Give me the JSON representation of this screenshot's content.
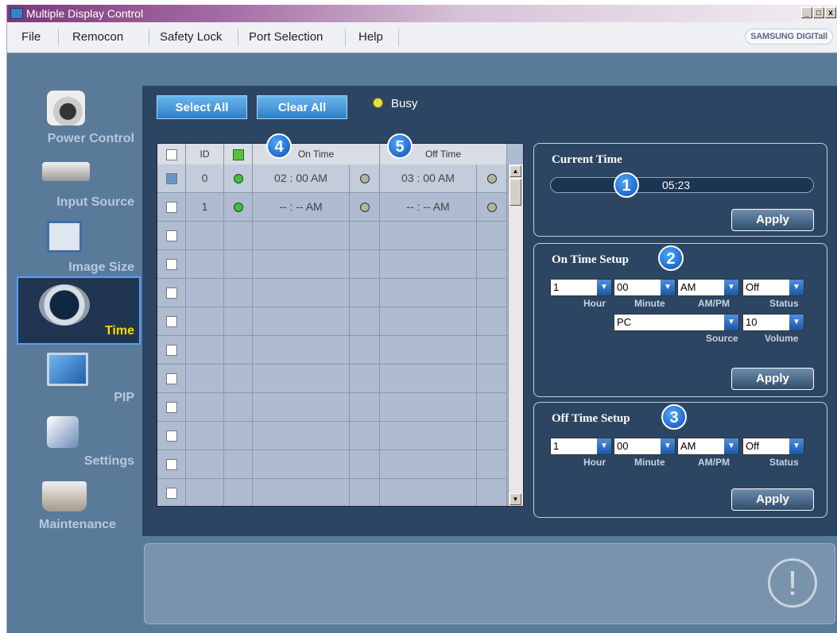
{
  "window": {
    "title": "Multiple Display Control",
    "min": "_",
    "max": "□",
    "close": "x"
  },
  "menu": {
    "items": [
      "File",
      "Remocon",
      "Safety Lock",
      "Port Selection",
      "Help"
    ],
    "brand": "SAMSUNG DIGITall"
  },
  "sidebar": {
    "items": [
      {
        "label": "Power Control",
        "icon": "power-control-icon"
      },
      {
        "label": "Input Source",
        "icon": "input-source-icon"
      },
      {
        "label": "Image Size",
        "icon": "image-size-icon"
      },
      {
        "label": "Time",
        "icon": "clock-icon",
        "active": true
      },
      {
        "label": "PIP",
        "icon": "pip-icon"
      },
      {
        "label": "Settings",
        "icon": "settings-icon"
      },
      {
        "label": "Maintenance",
        "icon": "maintenance-icon"
      }
    ]
  },
  "toolbar": {
    "select_all": "Select All",
    "clear_all": "Clear All",
    "busy": "Busy"
  },
  "grid": {
    "headers": {
      "id": "ID",
      "on_time": "On Time",
      "off_time": "Off Time"
    },
    "rows": [
      {
        "checked": true,
        "id": "0",
        "status": "green",
        "on_time": "02 : 00 AM",
        "on_led": "gray",
        "off_time": "03 : 00 AM",
        "off_led": "gray"
      },
      {
        "checked": false,
        "id": "1",
        "status": "green",
        "on_time": "-- : -- AM",
        "on_led": "gray",
        "off_time": "-- : -- AM",
        "off_led": "gray"
      }
    ],
    "empty_rows": 10
  },
  "callouts": [
    "1",
    "2",
    "3",
    "4",
    "5"
  ],
  "current_time": {
    "title": "Current Time",
    "value": "05:23",
    "apply": "Apply"
  },
  "on_time_setup": {
    "title": "On Time Setup",
    "hour": "1",
    "minute": "00",
    "ampm": "AM",
    "status": "Off",
    "source": "PC",
    "volume": "10",
    "labels": {
      "hour": "Hour",
      "minute": "Minute",
      "ampm": "AM/PM",
      "status": "Status",
      "source": "Source",
      "volume": "Volume"
    },
    "apply": "Apply"
  },
  "off_time_setup": {
    "title": "Off Time Setup",
    "hour": "1",
    "minute": "00",
    "ampm": "AM",
    "status": "Off",
    "labels": {
      "hour": "Hour",
      "minute": "Minute",
      "ampm": "AM/PM",
      "status": "Status"
    },
    "apply": "Apply"
  },
  "info_icon": "!"
}
